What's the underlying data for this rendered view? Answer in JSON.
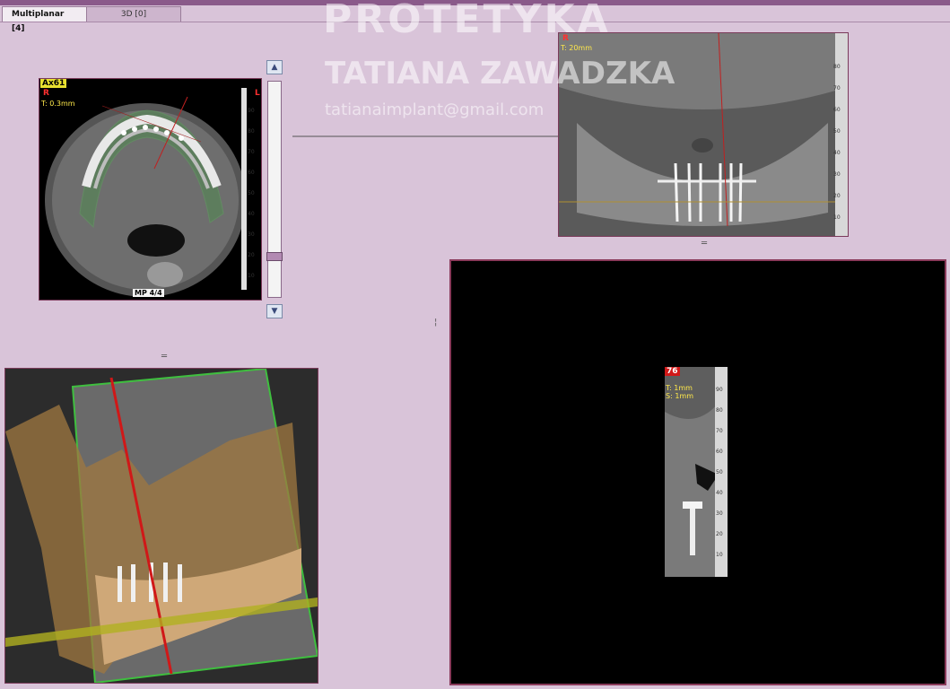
{
  "tabs": [
    {
      "label": "Multiplanar [4]",
      "active": true
    },
    {
      "label": "3D [0]",
      "active": false
    }
  ],
  "watermark": {
    "line1": "PROTETYKA",
    "line2": "TATIANA ZAWADZKA",
    "line3": "tatianaimplant@gmail.com"
  },
  "axial_view": {
    "badge": "Ax61",
    "side_marker": "R",
    "side_marker_right": "L",
    "thickness": "T: 0.3mm",
    "caption": "MP 4/4",
    "ruler_ticks": [
      "90",
      "80",
      "70",
      "60",
      "50",
      "40",
      "30",
      "20",
      "10"
    ]
  },
  "panoramic_view": {
    "side_marker": "R",
    "thickness": "T: 20mm",
    "ruler_ticks": [
      "80",
      "70",
      "60",
      "50",
      "40",
      "30",
      "20",
      "10"
    ]
  },
  "cross_section_view": {
    "badge": "76",
    "thickness": "T: 1mm",
    "spacing": "S: 1mm",
    "ruler_ticks": [
      "90",
      "80",
      "70",
      "60",
      "50",
      "40",
      "30",
      "20",
      "10"
    ]
  },
  "slider": {
    "up_icon": "▲",
    "down_icon": "▼"
  },
  "colors": {
    "accent": "#8a5a8a",
    "background": "#d9c4d9",
    "badge_yellow": "#e8e030",
    "badge_red": "#d01818"
  }
}
